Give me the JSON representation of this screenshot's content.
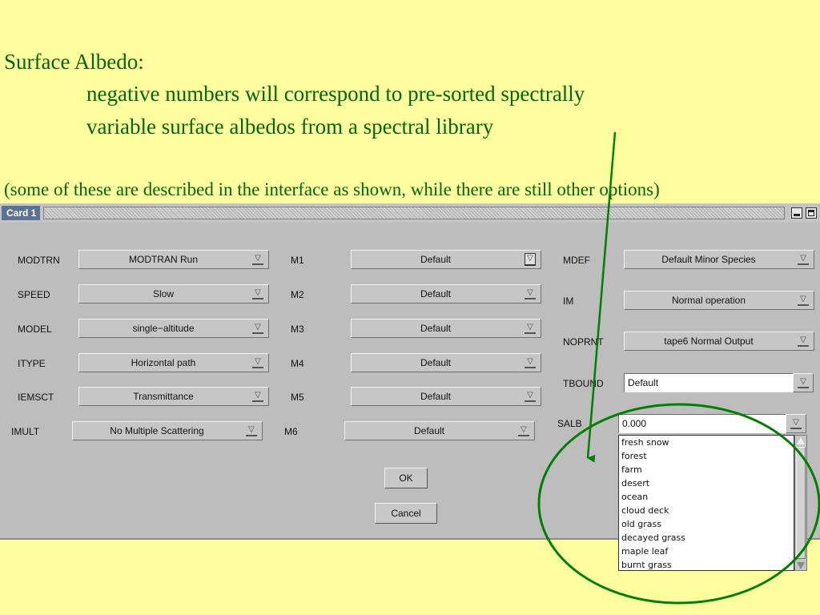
{
  "slide": {
    "title": "Surface Albedo:",
    "line1": "negative numbers will correspond to pre-sorted spectrally",
    "line2": "variable surface albedos from a spectral library",
    "note": "(some of these are described in the interface as shown, while there are still other options)"
  },
  "window": {
    "title": "Card 1"
  },
  "fields": {
    "modtrn": {
      "label": "MODTRN",
      "value": "MODTRAN Run"
    },
    "speed": {
      "label": "SPEED",
      "value": "Slow"
    },
    "model": {
      "label": "MODEL",
      "value": "single−altitude"
    },
    "itype": {
      "label": "ITYPE",
      "value": "Horizontal path"
    },
    "iemsct": {
      "label": "IEMSCT",
      "value": "Transmittance"
    },
    "imult": {
      "label": "IMULT",
      "value": "No Multiple Scattering"
    },
    "m1": {
      "label": "M1",
      "value": "Default"
    },
    "m2": {
      "label": "M2",
      "value": "Default"
    },
    "m3": {
      "label": "M3",
      "value": "Default"
    },
    "m4": {
      "label": "M4",
      "value": "Default"
    },
    "m5": {
      "label": "M5",
      "value": "Default"
    },
    "m6": {
      "label": "M6",
      "value": "Default"
    },
    "mdef": {
      "label": "MDEF",
      "value": "Default Minor Species"
    },
    "im": {
      "label": "IM",
      "value": "Normal operation"
    },
    "noprnt": {
      "label": "NOPRNT",
      "value": "tape6 Normal Output"
    },
    "tbound": {
      "label": "TBOUND",
      "value": "Default"
    },
    "salb": {
      "label": "SALB",
      "value": "0.000"
    }
  },
  "salb_options": [
    "fresh snow",
    "forest",
    "farm",
    "desert",
    "ocean",
    "cloud deck",
    "old grass",
    "decayed grass",
    "maple leaf",
    "burnt grass"
  ],
  "buttons": {
    "ok": "OK",
    "cancel": "Cancel"
  },
  "icons": {
    "dropdown": "dropdown-arrow-icon",
    "minimize": "minimize-icon",
    "maximize": "maximize-icon"
  },
  "colors": {
    "background": "#ffffa0",
    "text": "#006600",
    "annotation": "#008000",
    "window": "#bdbdbd"
  }
}
